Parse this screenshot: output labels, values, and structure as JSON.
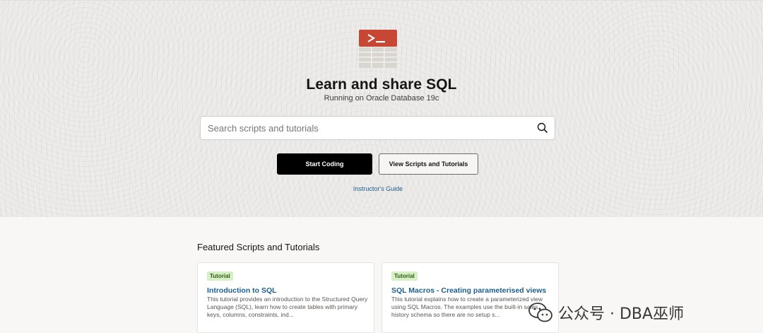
{
  "hero": {
    "title": "Learn and share SQL",
    "subtitle": "Running on Oracle Database 19c",
    "logo_icon": "sql-terminal-logo-icon",
    "accent_color": "#c74634"
  },
  "search": {
    "placeholder": "Search scripts and tutorials",
    "value": "",
    "icon": "search-icon"
  },
  "actions": {
    "start_coding_label": "Start Coding",
    "view_scripts_label": "View Scripts and Tutorials",
    "instructors_guide_label": "Instructor's Guide"
  },
  "featured": {
    "heading": "Featured Scripts and Tutorials",
    "cards": [
      {
        "badge": "Tutorial",
        "title": "Introduction to SQL",
        "description": "This tutorial provides an introduction to the Structured Query Language (SQL), learn how to create tables with primary keys, columns, constraints, ind..."
      },
      {
        "badge": "Tutorial",
        "title": "SQL Macros - Creating parameterised views",
        "description": "This tutorial explains how to create a parameterized view using SQL Macros. The examples use the built-in sales history schema so there are no setup s..."
      }
    ]
  },
  "watermark": {
    "text": "公众号 · DBA巫师",
    "icon": "wechat-logo-icon"
  }
}
